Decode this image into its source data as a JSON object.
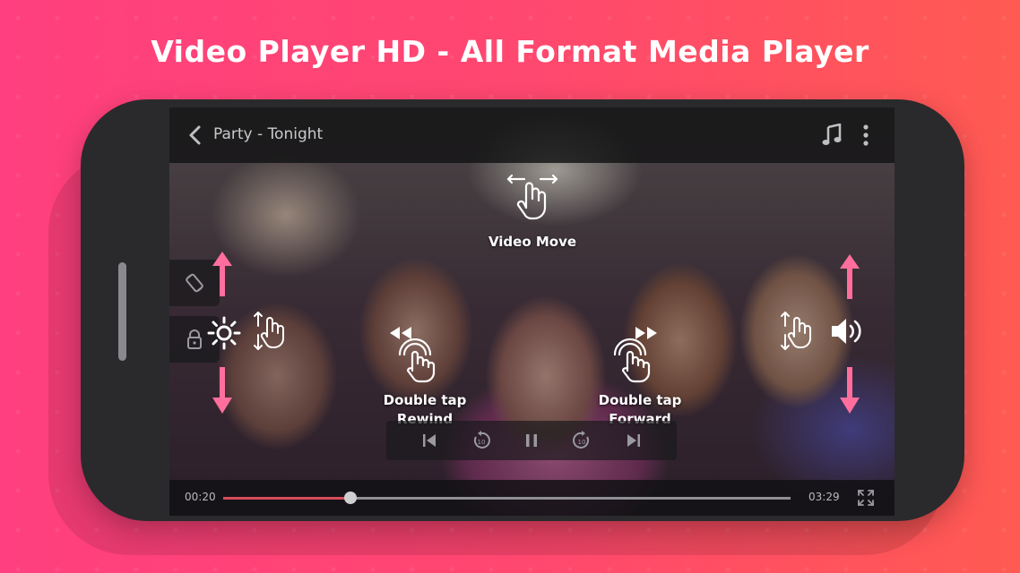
{
  "headline": "Video Player HD - All Format Media Player",
  "player": {
    "title": "Party - Tonight",
    "current_time": "00:20",
    "duration": "03:29",
    "progress": 0.225
  },
  "hints": {
    "video_move": "Video Move",
    "rewind_line1": "Double tap",
    "rewind_line2": "Rewind",
    "forward_line1": "Double tap",
    "forward_line2": "Forward"
  },
  "icons": {
    "back": "chevron-left-icon",
    "music": "music-note-icon",
    "more": "more-vertical-icon",
    "rotate": "rotate-screen-icon",
    "lock": "lock-icon",
    "brightness": "sun-icon",
    "volume": "speaker-icon",
    "fullscreen": "fullscreen-icon"
  },
  "colors": {
    "accent": "#ff4574",
    "progress": "#d84b5b",
    "arrow": "#ff6e9c"
  }
}
